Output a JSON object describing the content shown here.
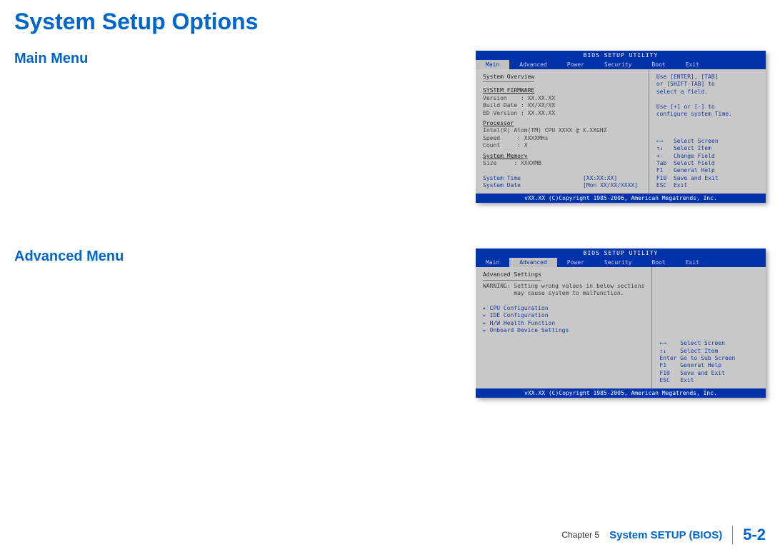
{
  "title": "System Setup Options",
  "sections": {
    "main_label": "Main Menu",
    "advanced_label": "Advanced Menu"
  },
  "bios_main": {
    "header": "BIOS SETUP UTILITY",
    "tabs": [
      "Main",
      "Advanced",
      "Power",
      "Security",
      "Boot",
      "Exit"
    ],
    "active_tab": "Main",
    "overview": "System Overview",
    "firmware_head": "SYSTEM FIRMWARE",
    "fw_version": "Version    : XX.XX.XX",
    "fw_build": "Build Date : XX/XX/XX",
    "fw_ed": "ED Version : XX.XX.XX",
    "proc_head": "Processor",
    "proc_cpu": "Intel(R) Atom(TM) CPU XXXX @ X.XXGHZ",
    "proc_speed": "Speed     : XXXXMHs",
    "proc_count": "Count     : X",
    "mem_head": "System Memory",
    "mem_size": "Size     : XXXXMB",
    "time_label": "System Time",
    "time_value": "[XX:XX:XX]",
    "date_label": "System Date",
    "date_value": "[Mon XX/XX/XXXX]",
    "help_top": "Use [ENTER], [TAB]\nor [SHIFT-TAB] to\nselect a field.\n\nUse [+] or [-] to\nconfigure system Time.",
    "help_keys": "←→   Select Screen\n↑↓   Select Item\n+-   Change Field\nTab  Select Field\nF1   General Help\nF10  Save and Exit\nESC  Exit",
    "footer": "vXX.XX (C)Copyright 1985-2006, American Megatrends, Inc."
  },
  "bios_adv": {
    "header": "BIOS SETUP UTILITY",
    "tabs": [
      "Main",
      "Advanced",
      "Power",
      "Security",
      "Boot",
      "Exit"
    ],
    "active_tab": "Advanced",
    "settings_head": "Advanced Settings",
    "warning_l1": "WARNING: Setting wrong values in below sections",
    "warning_l2": "         may cause system to malfunction.",
    "items": [
      "▸ CPU Configuration",
      "▸ IDE Configuration",
      "▸ H/W Health Function",
      "▸ Onboard Device Settings"
    ],
    "help_keys": "←→    Select Screen\n↑↓    Select Item\nEnter Go to Sub Screen\nF1    General Help\nF10   Save and Exit\nESC   Exit",
    "footer": "vXX.XX (C)Copyright 1985-2005, American Megatrends, Inc."
  },
  "footer": {
    "chapter": "Chapter 5",
    "title": "System SETUP (BIOS)",
    "page": "5-2"
  }
}
